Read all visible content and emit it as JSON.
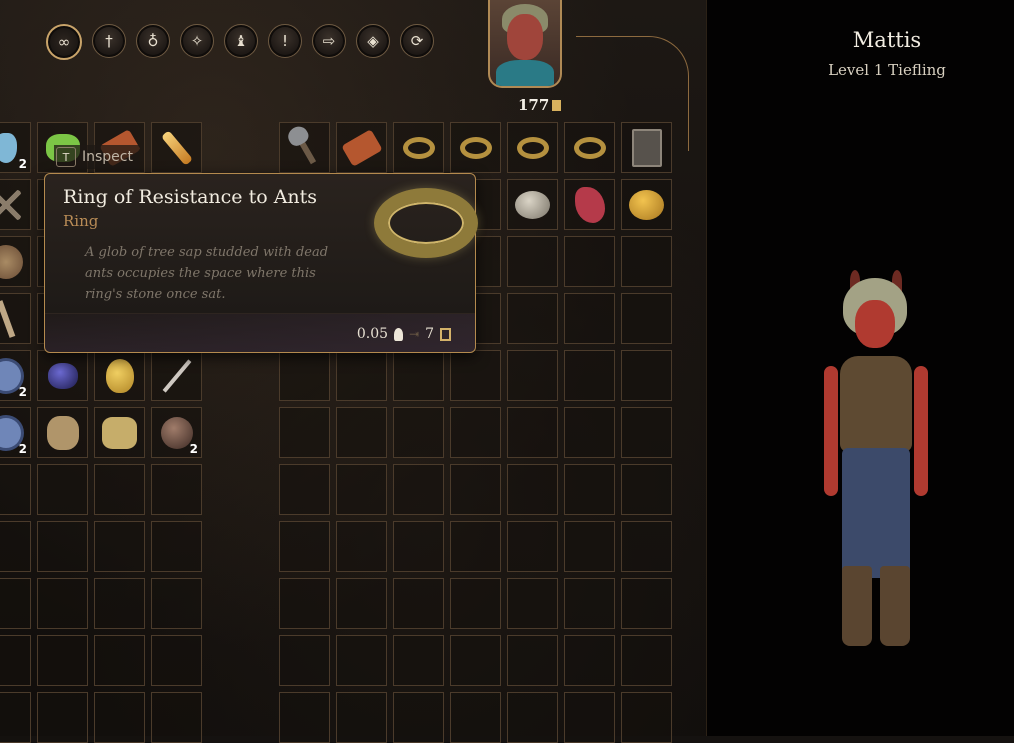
{
  "filters": [
    {
      "name": "all-items-icon",
      "glyph": "∞",
      "active": true
    },
    {
      "name": "weapons-icon",
      "glyph": "†",
      "active": false
    },
    {
      "name": "consumables-icon",
      "glyph": "♁",
      "active": false
    },
    {
      "name": "magic-icon",
      "glyph": "✧",
      "active": false
    },
    {
      "name": "alchemy-icon",
      "glyph": "♝",
      "active": false
    },
    {
      "name": "quest-items-icon",
      "glyph": "!",
      "active": false
    },
    {
      "name": "scrolls-icon",
      "glyph": "⇨",
      "active": false
    },
    {
      "name": "armour-icon",
      "glyph": "◈",
      "active": false
    },
    {
      "name": "misc-icon",
      "glyph": "⟳",
      "active": false
    }
  ],
  "party": {
    "gold": "177"
  },
  "character": {
    "name": "Mattis",
    "subtitle": "Level 1 Tiefling"
  },
  "inspect": {
    "key": "T",
    "label": "Inspect"
  },
  "tooltip": {
    "title": "Ring of Resistance to Ants",
    "type": "Ring",
    "description": "A glob of tree sap studded with dead ants occupies the space where this ring's stone once sat.",
    "weight": "0.05",
    "value": "7"
  },
  "left_grid": {
    "cols": 4,
    "rows": 11,
    "cells": [
      {
        "item": "it-potion",
        "count": "2"
      },
      {
        "item": "it-green"
      },
      {
        "item": "it-scroll"
      },
      {
        "item": "it-torch"
      },
      {
        "item": "it-cross"
      },
      {},
      {},
      {},
      {
        "item": "it-shield"
      },
      {},
      {},
      {},
      {
        "item": "it-blade"
      },
      {},
      {},
      {},
      {
        "item": "it-spiky",
        "count": "2"
      },
      {
        "item": "it-gem"
      },
      {
        "item": "it-pear"
      },
      {
        "item": "it-feather"
      },
      {
        "item": "it-spiky",
        "count": "2"
      },
      {
        "item": "it-bear"
      },
      {
        "item": "it-pouch"
      },
      {
        "item": "it-orb",
        "count": "2"
      }
    ]
  },
  "right_grid": {
    "cols": 7,
    "rows": 11,
    "cells": [
      {
        "item": "it-shovel"
      },
      {
        "item": "it-scroll"
      },
      {
        "item": "it-ring"
      },
      {
        "item": "it-ring"
      },
      {
        "item": "it-ring"
      },
      {
        "item": "it-ring"
      },
      {
        "item": "it-book"
      },
      {},
      {},
      {},
      {},
      {
        "item": "it-stone"
      },
      {
        "item": "it-meat"
      },
      {
        "item": "it-potato"
      }
    ]
  }
}
